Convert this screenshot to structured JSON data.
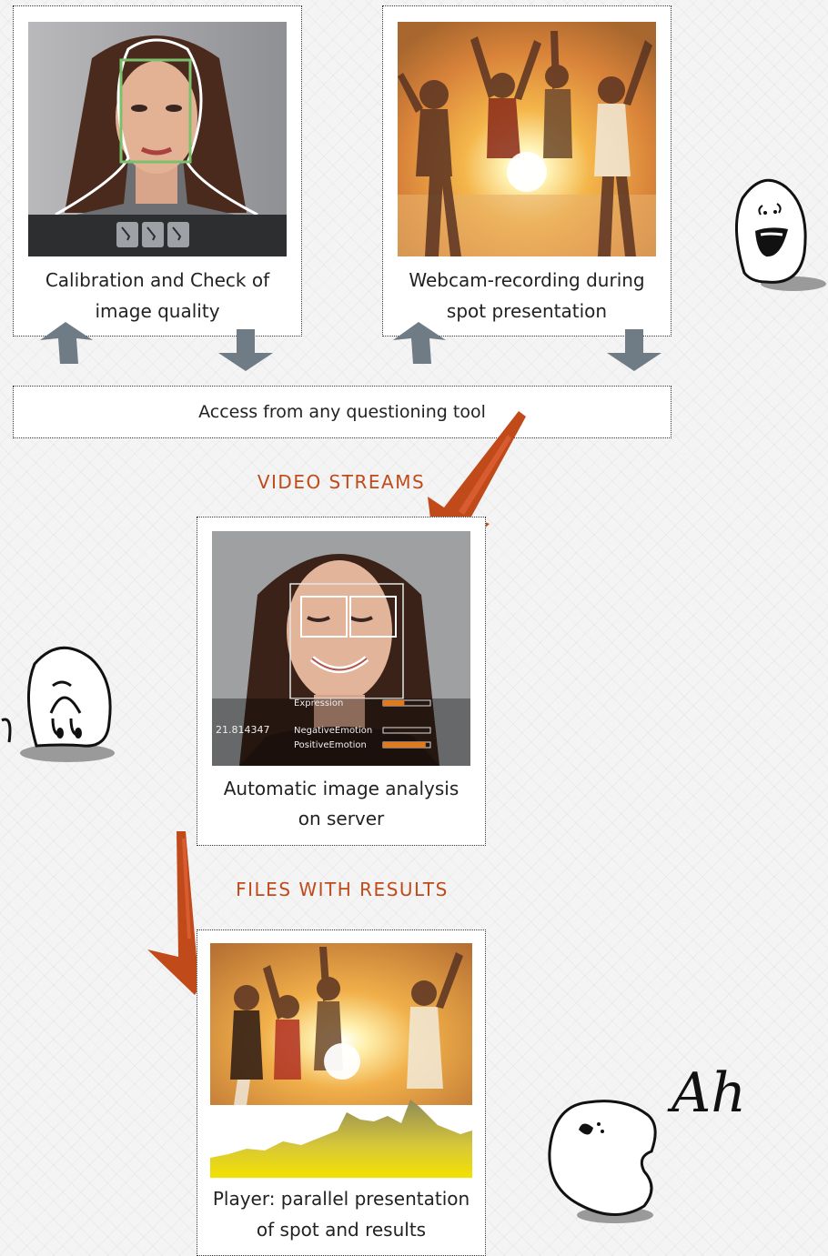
{
  "boxes": {
    "calibration": {
      "caption_line1": "Calibration and Check of",
      "caption_line2": "image quality"
    },
    "webcam": {
      "caption_line1": "Webcam-recording during",
      "caption_line2": "spot presentation"
    },
    "analysis": {
      "caption_line1": "Automatic image analysis",
      "caption_line2": "on server",
      "overlay": {
        "expression_label": "Expression",
        "id_number": "21.814347",
        "negative_label": "NegativeEmotion",
        "positive_label": "PositiveEmotion",
        "expression_level": 0.45,
        "negative_level": 0.0,
        "positive_level": 0.9
      }
    },
    "player": {
      "caption_line1": "Player: parallel presentation",
      "caption_line2": "of spot and results"
    }
  },
  "access_label": "Access from any questioning tool",
  "labels": {
    "video_streams": "VIDEO STREAMS",
    "files_with_results": "FILES WITH RESULTS"
  },
  "calibration_toolbar": [
    "x1",
    "x2",
    "x3"
  ],
  "doodle_text": "Ah",
  "colors": {
    "accent": "#c14a1a",
    "arrow_gray": "#6f7b85",
    "chart_yellow": "#e8d400"
  }
}
